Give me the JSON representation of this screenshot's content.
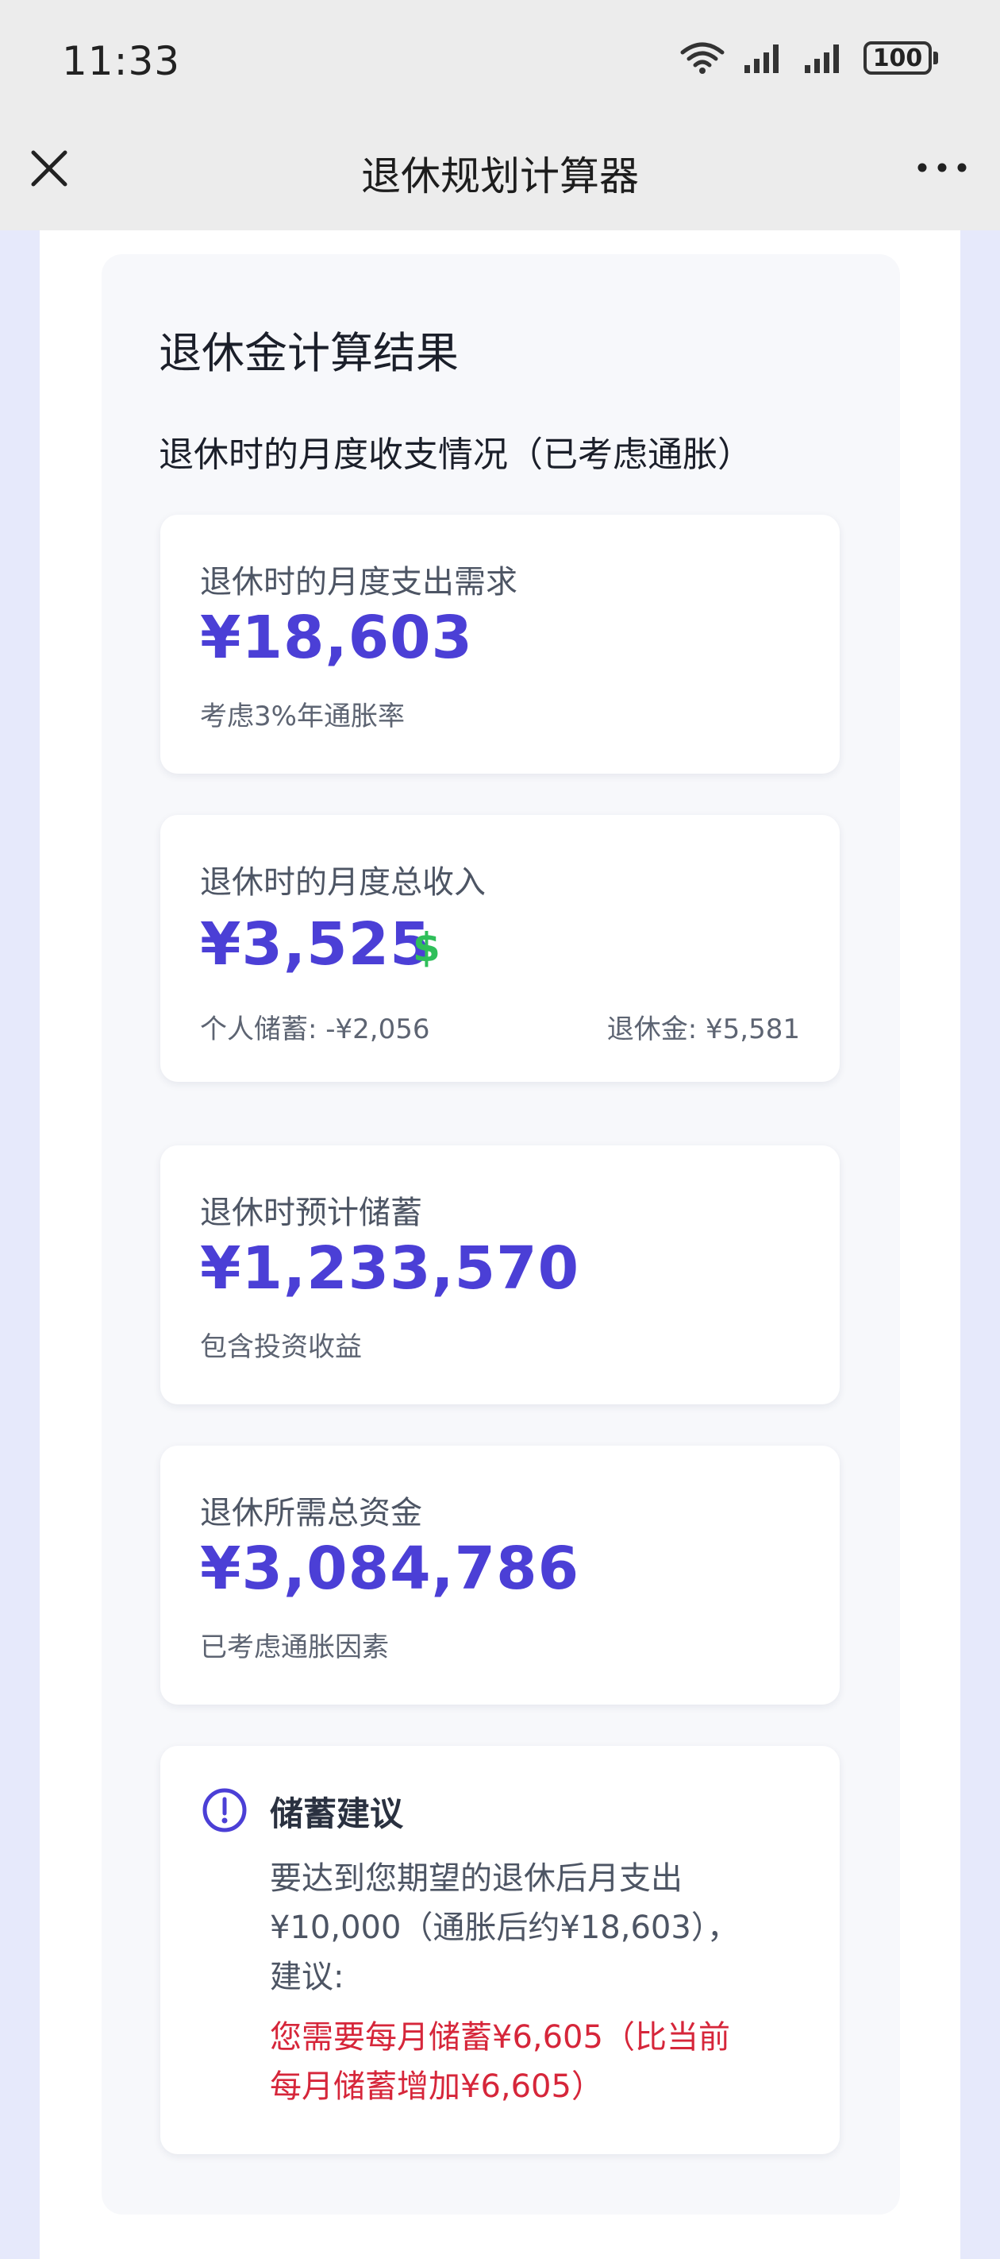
{
  "status_bar": {
    "time": "11:33",
    "battery_level": "100",
    "icons": [
      "wifi-icon",
      "signal-icon",
      "signal-icon",
      "battery-icon"
    ]
  },
  "nav": {
    "title": "退休规划计算器",
    "close_icon": "close-icon",
    "more_icon": "more-icon"
  },
  "result": {
    "title": "退休金计算结果",
    "subtitle": "退休时的月度收支情况（已考虑通胀）",
    "cards": {
      "expense": {
        "label": "退休时的月度支出需求",
        "value": "¥18,603",
        "note": "考虑3%年通胀率"
      },
      "income": {
        "label": "退休时的月度总收入",
        "value": "¥3,525",
        "savings_note": "个人储蓄: -¥2,056",
        "pension_note": "退休金: ¥5,581",
        "icon": "dollar-icon"
      },
      "savings": {
        "label": "退休时预计储蓄",
        "value": "¥1,233,570",
        "note": "包含投资收益"
      },
      "total": {
        "label": "退休所需总资金",
        "value": "¥3,084,786",
        "note": "已考虑通胀因素"
      }
    },
    "advice": {
      "title": "储蓄建议",
      "icon": "alert-circle-icon",
      "lines": [
        "要达到您期望的退休后月支出",
        "¥10,000（通胀后约¥18,603），",
        "建议:"
      ],
      "highlight_lines": [
        "您需要每月储蓄¥6,605（比当前",
        "每月储蓄增加¥6,605）"
      ]
    }
  },
  "colors": {
    "accent": "#4b3fd6",
    "warning": "#d6263a",
    "positive": "#2fbf5a"
  }
}
